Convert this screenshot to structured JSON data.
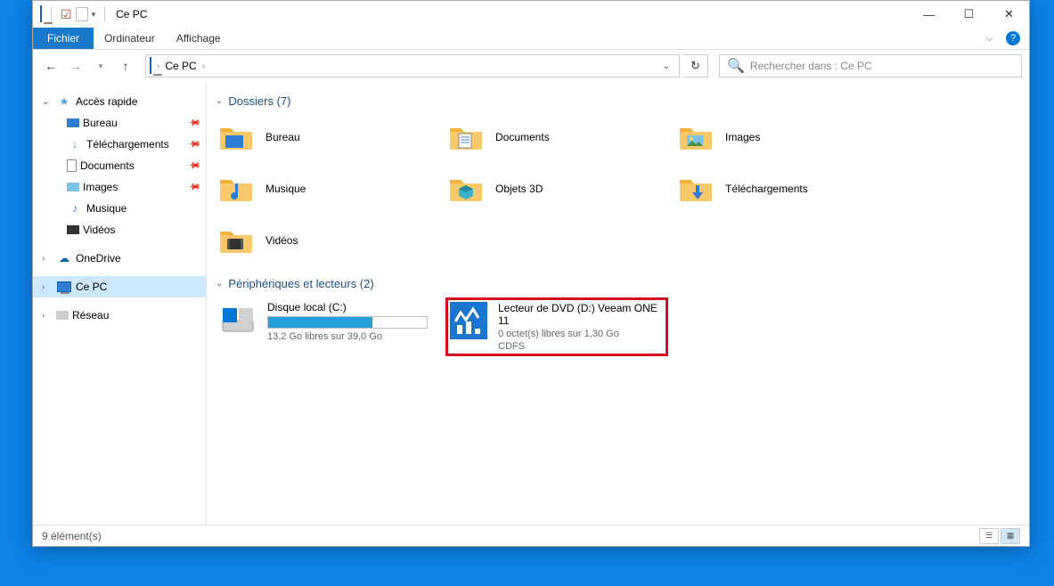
{
  "titlebar": {
    "title": "Ce PC"
  },
  "ribbon": {
    "file": "Fichier",
    "tabs": [
      "Ordinateur",
      "Affichage"
    ]
  },
  "breadcrumb": {
    "location": "Ce PC"
  },
  "search": {
    "placeholder": "Rechercher dans : Ce PC"
  },
  "sidebar": {
    "quick": {
      "label": "Accès rapide",
      "items": [
        "Bureau",
        "Téléchargements",
        "Documents",
        "Images",
        "Musique",
        "Vidéos"
      ]
    },
    "onedrive": "OneDrive",
    "thispc": "Ce PC",
    "network": "Réseau"
  },
  "groups": {
    "folders": {
      "title": "Dossiers (7)",
      "items": [
        "Bureau",
        "Documents",
        "Images",
        "Musique",
        "Objets 3D",
        "Téléchargements",
        "Vidéos"
      ]
    },
    "drives": {
      "title": "Périphériques et lecteurs (2)",
      "local": {
        "name": "Disque local (C:)",
        "free": "13,2 Go libres sur 39,0 Go",
        "fill_pct": 66
      },
      "dvd": {
        "name": "Lecteur de DVD (D:) Veeam ONE 11",
        "free": "0 octet(s) libres sur 1,30 Go",
        "fs": "CDFS"
      }
    }
  },
  "status": {
    "count": "9 élément(s)"
  }
}
